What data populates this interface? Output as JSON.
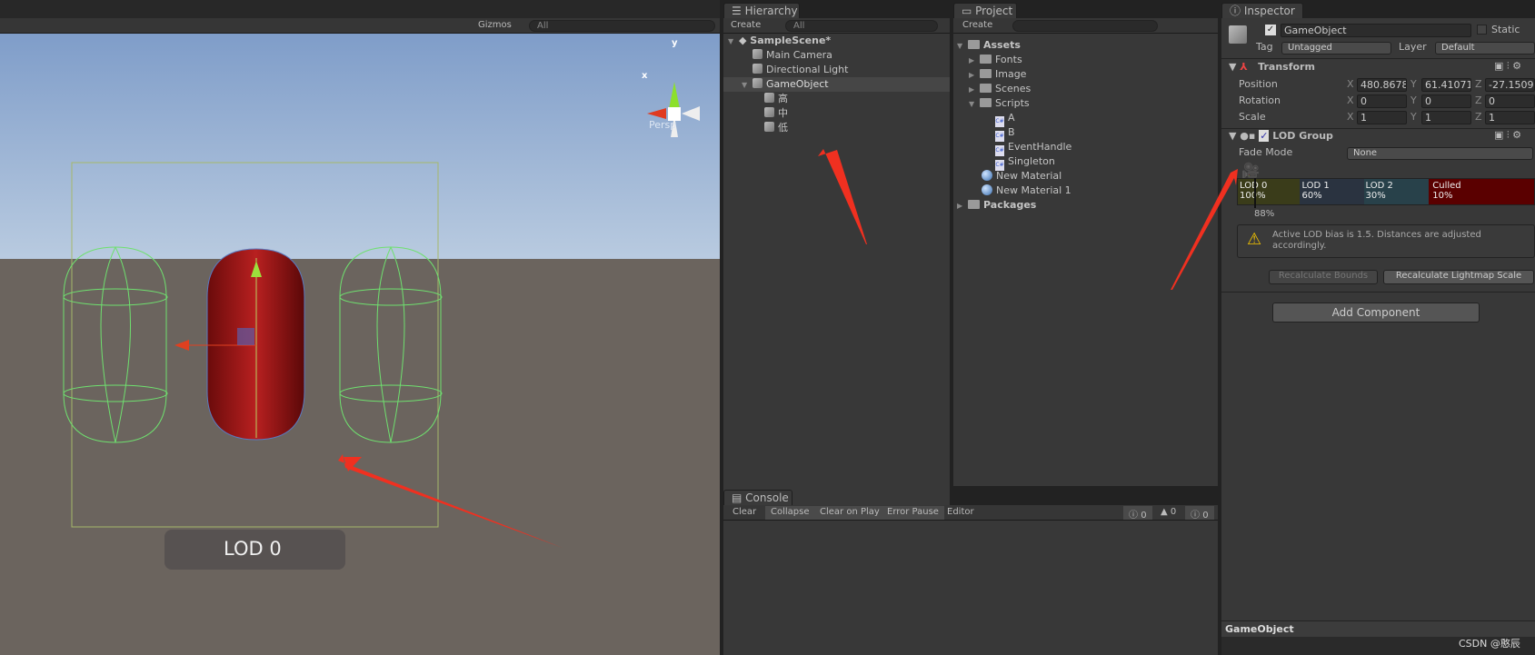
{
  "scene": {
    "gizmos_label": "Gizmos",
    "search_placeholder": "All",
    "axis_y": "y",
    "axis_x": "x",
    "projection": "Persp",
    "lod_label": "LOD 0"
  },
  "hierarchy": {
    "tab": "Hierarchy",
    "create": "Create",
    "search_placeholder": "All",
    "scene_name": "SampleScene*",
    "items": [
      "Main Camera",
      "Directional Light",
      "GameObject",
      "高",
      "中",
      "低"
    ]
  },
  "project": {
    "tab": "Project",
    "create": "Create",
    "assets": "Assets",
    "folders": [
      "Fonts",
      "Image",
      "Scenes",
      "Scripts"
    ],
    "scripts": [
      "A",
      "B",
      "EventHandle",
      "Singleton"
    ],
    "materials": [
      "New Material",
      "New Material 1"
    ],
    "packages": "Packages"
  },
  "console": {
    "tab": "Console",
    "buttons": [
      "Clear",
      "Collapse",
      "Clear on Play",
      "Error Pause",
      "Editor"
    ],
    "counts": {
      "info": "0",
      "warning": "0",
      "error": "0"
    }
  },
  "inspector": {
    "tab": "Inspector",
    "name": "GameObject",
    "static": "Static",
    "tag_label": "Tag",
    "tag": "Untagged",
    "layer_label": "Layer",
    "layer": "Default",
    "transform": {
      "title": "Transform",
      "position_label": "Position",
      "rotation_label": "Rotation",
      "scale_label": "Scale",
      "position": {
        "x": "480.8678",
        "y": "61.41071",
        "z": "-27.1509"
      },
      "rotation": {
        "x": "0",
        "y": "0",
        "z": "0"
      },
      "scale": {
        "x": "1",
        "y": "1",
        "z": "1"
      }
    },
    "lod_group": {
      "title": "LOD Group",
      "fade_mode_label": "Fade Mode",
      "fade_mode": "None",
      "levels": [
        {
          "name": "LOD 0",
          "pct": "100%",
          "color": "#3a3c1a"
        },
        {
          "name": "LOD 1",
          "pct": "60%",
          "color": "#2a3340"
        },
        {
          "name": "LOD 2",
          "pct": "30%",
          "color": "#28414a"
        },
        {
          "name": "Culled",
          "pct": "10%",
          "color": "#5a0000"
        }
      ],
      "current": "88%",
      "warning": "Active LOD bias is 1.5. Distances are adjusted accordingly.",
      "recalc_bounds": "Recalculate Bounds",
      "recalc_lightmap": "Recalculate Lightmap Scale"
    },
    "add_component": "Add Component",
    "preview_title": "GameObject"
  },
  "watermark": "CSDN @憨辰"
}
